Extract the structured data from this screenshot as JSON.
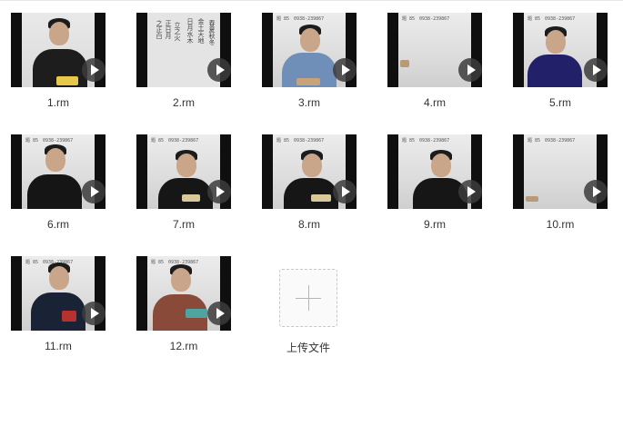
{
  "files": [
    {
      "name": "1.rm",
      "icon": "play-icon"
    },
    {
      "name": "2.rm",
      "icon": "play-icon"
    },
    {
      "name": "3.rm",
      "icon": "play-icon"
    },
    {
      "name": "4.rm",
      "icon": "play-icon"
    },
    {
      "name": "5.rm",
      "icon": "play-icon"
    },
    {
      "name": "6.rm",
      "icon": "play-icon"
    },
    {
      "name": "7.rm",
      "icon": "play-icon"
    },
    {
      "name": "8.rm",
      "icon": "play-icon"
    },
    {
      "name": "9.rm",
      "icon": "play-icon"
    },
    {
      "name": "10.rm",
      "icon": "play-icon"
    },
    {
      "name": "11.rm",
      "icon": "play-icon"
    },
    {
      "name": "12.rm",
      "icon": "play-icon"
    }
  ],
  "upload": {
    "label": "上传文件",
    "icon": "plus-icon"
  },
  "colors": {
    "thumb_background": "#0f0f0f",
    "label_text": "#333333",
    "upload_border": "#c8c8c8"
  }
}
